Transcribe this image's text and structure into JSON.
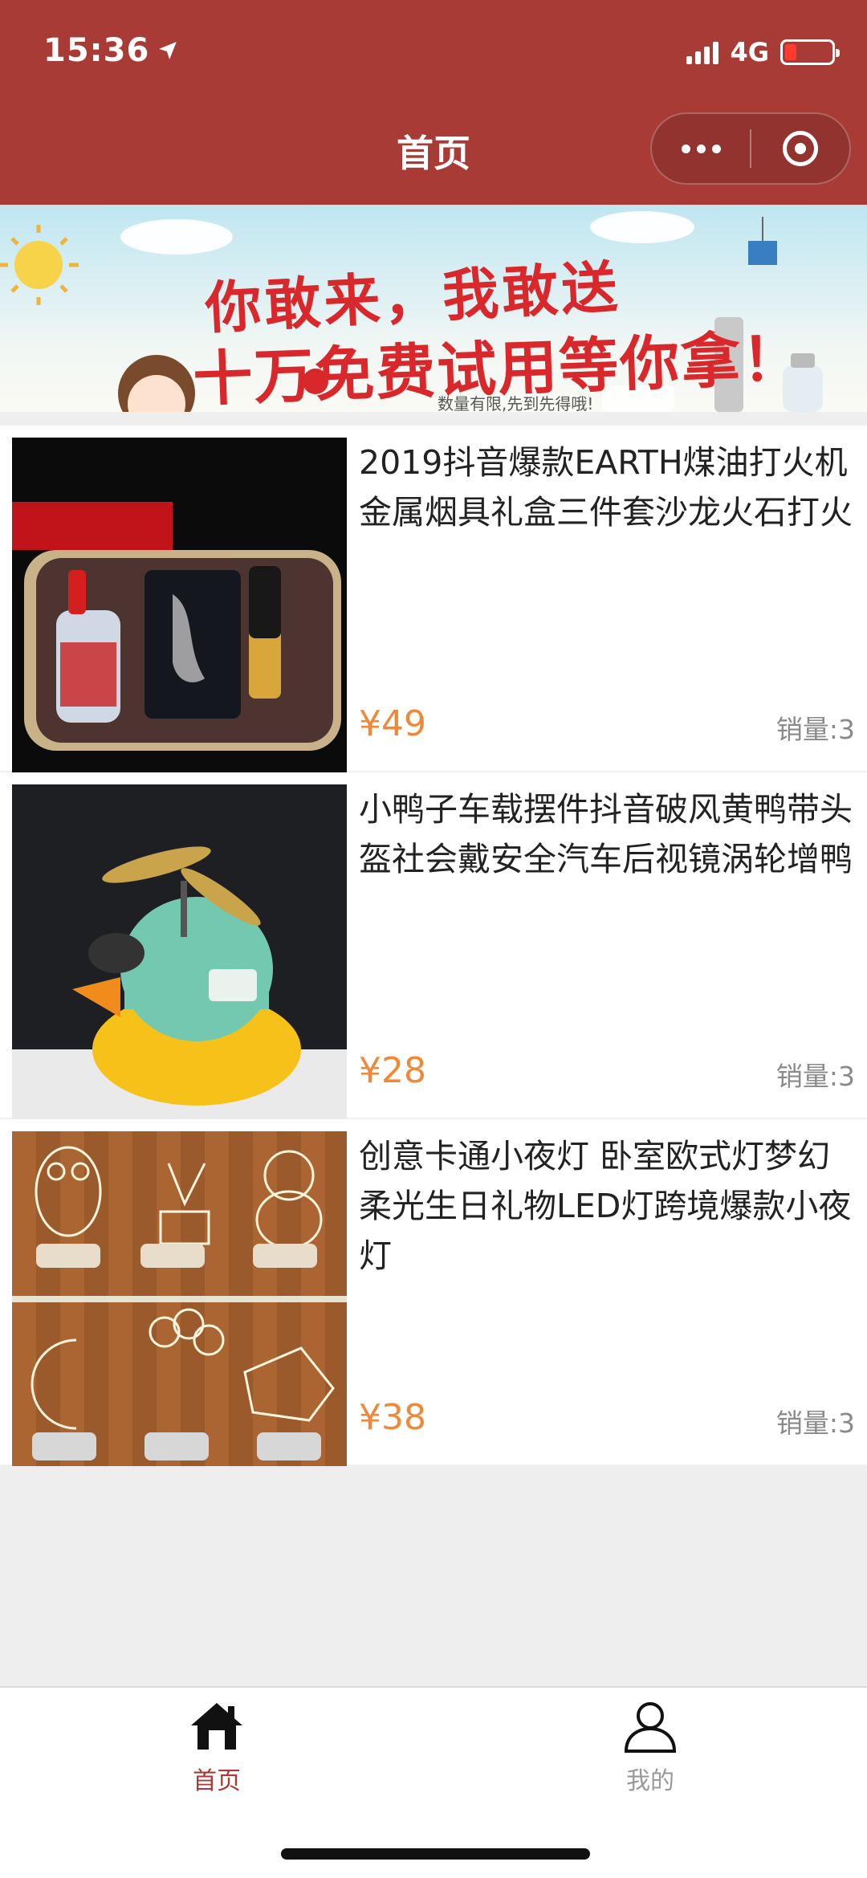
{
  "status_bar": {
    "time": "15:36",
    "network": "4G"
  },
  "nav": {
    "title": "首页"
  },
  "banner": {
    "line1": "你敢来，我敢送",
    "line2": "十万免费试用等你拿！",
    "note": "数量有限,先到先得哦!"
  },
  "products": [
    {
      "title": "2019抖音爆款EARTH煤油打火机金属烟具礼盒三件套沙龙火石打火",
      "price": "¥49",
      "sales": "销量:3"
    },
    {
      "title": "小鸭子车载摆件抖音破风黄鸭带头盔社会戴安全汽车后视镜涡轮增鸭",
      "price": "¥28",
      "sales": "销量:3"
    },
    {
      "title": "创意卡通小夜灯 卧室欧式灯梦幻柔光生日礼物LED灯跨境爆款小夜灯",
      "price": "¥38",
      "sales": "销量:3"
    }
  ],
  "tabbar": {
    "home": {
      "label": "首页",
      "icon": "home-icon",
      "color": "#a83b36"
    },
    "mine": {
      "label": "我的",
      "icon": "user-icon",
      "color": "#999999"
    }
  },
  "colors": {
    "theme": "#a83b36",
    "price": "#f0883a"
  }
}
